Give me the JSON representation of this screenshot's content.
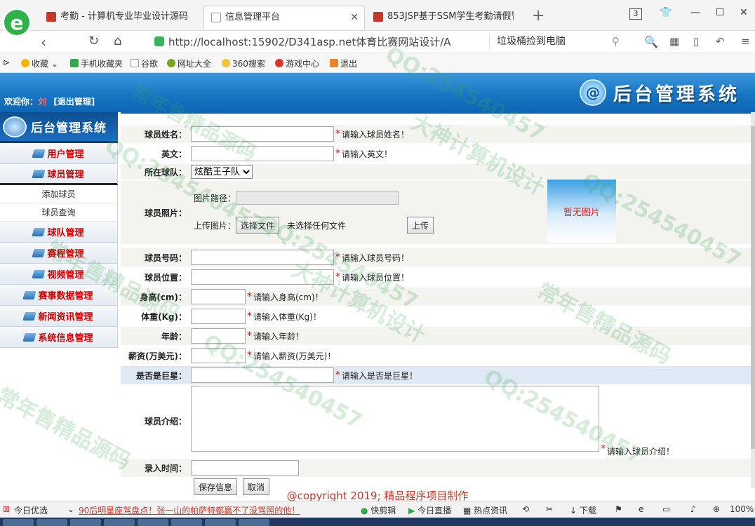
{
  "browser": {
    "tabs": [
      {
        "title": "考勤 - 计算机专业毕业设计源码",
        "active": false
      },
      {
        "title": "信息管理平台",
        "active": true
      },
      {
        "title": "853JSP基于SSM学生考勤请假管",
        "active": false
      }
    ],
    "tab_count": "3",
    "url": "http://localhost:15902/D341asp.net体育比赛网站设计/A",
    "search_text": "垃圾桶捡到电脑"
  },
  "bookmarks": [
    "收藏",
    "手机收藏夹",
    "谷歌",
    "网址大全",
    "360搜索",
    "游戏中心",
    "退出"
  ],
  "header": {
    "welcome": "欢迎你：",
    "username": "刘",
    "logout": "[退出管理]",
    "system_title": "后台管理系统"
  },
  "sidebar": {
    "title": "后台管理系统",
    "menu": [
      {
        "label": "用户管理"
      },
      {
        "label": "球员管理",
        "open": true,
        "children": [
          "添加球员",
          "球员查询"
        ]
      },
      {
        "label": "球队管理"
      },
      {
        "label": "赛程管理"
      },
      {
        "label": "视频管理"
      },
      {
        "label": "赛事数据管理"
      },
      {
        "label": "新闻资讯管理"
      },
      {
        "label": "系统信息管理"
      }
    ]
  },
  "form": {
    "name": {
      "label": "球员姓名：",
      "hint": "请输入球员姓名！"
    },
    "english": {
      "label": "英文：",
      "hint": "请输入英文！"
    },
    "team": {
      "label": "所在球队：",
      "selected": "炫酷王子队"
    },
    "photo": {
      "label": "球员照片：",
      "path_label": "图片路径：",
      "upload_label": "上传图片：",
      "choose_button": "选择文件",
      "no_file": "未选择任何文件",
      "upload_button": "上传",
      "no_image": "暂无图片"
    },
    "number": {
      "label": "球员号码：",
      "hint": "请输入球员号码！"
    },
    "position": {
      "label": "球员位置：",
      "hint": "请输入球员位置！"
    },
    "height": {
      "label": "身高(cm)：",
      "hint": "请输入身高(cm)！"
    },
    "weight": {
      "label": "体重(Kg)：",
      "hint": "请输入体重(Kg)！"
    },
    "age": {
      "label": "年龄：",
      "hint": "请输入年龄！"
    },
    "salary": {
      "label": "薪资(万美元)：",
      "hint": "请输入薪资(万美元)！"
    },
    "star": {
      "label": "是否是巨星：",
      "hint": "请输入是否是巨星！"
    },
    "intro": {
      "label": "球员介绍：",
      "hint": "请输入球员介绍！"
    },
    "entry_time": {
      "label": "录入时间："
    },
    "save_button": "保存信息",
    "cancel_button": "取消"
  },
  "footer": {
    "copyright": "@copyright 2019; 精品程序项目制作"
  },
  "statusbar": {
    "left": "今日优选",
    "news": "90后明星座驾盘点！张一山的帕萨特都赢不了没驾照的他！",
    "items": [
      "快剪辑",
      "今日直播",
      "热点资讯",
      "下载"
    ],
    "zoom": "100%"
  },
  "watermark": {
    "a": "QQ:254540457",
    "b": "常年售精品源码",
    "c": "大神计算机设计"
  }
}
